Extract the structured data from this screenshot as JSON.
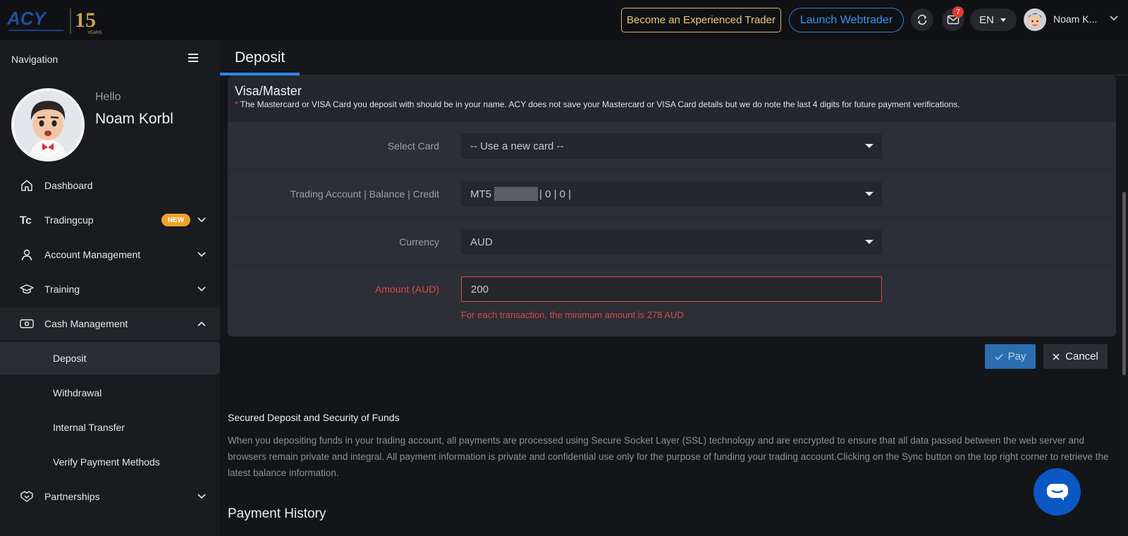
{
  "header": {
    "brand_text": "ACY",
    "anniversary": "15 YEARS",
    "become_trader_label": "Become an Experienced Trader",
    "launch_webtrader_label": "Launch Webtrader",
    "mail_count": "7",
    "language": "EN",
    "user_name": "Noam K..."
  },
  "sidebar": {
    "title": "Navigation",
    "hello": "Hello",
    "user_name": "Noam Korbl",
    "items": [
      {
        "label": "Dashboard",
        "icon": "home-icon"
      },
      {
        "label": "Tradingcup",
        "icon": "tc-icon",
        "badge": "NEW"
      },
      {
        "label": "Account Management",
        "icon": "user-icon"
      },
      {
        "label": "Training",
        "icon": "graduation-cap-icon"
      },
      {
        "label": "Cash Management",
        "icon": "cash-icon"
      },
      {
        "label": "Partnerships",
        "icon": "handshake-icon"
      }
    ],
    "sub_items": [
      {
        "label": "Deposit",
        "active": true
      },
      {
        "label": "Withdrawal"
      },
      {
        "label": "Internal Transfer"
      },
      {
        "label": "Verify Payment Methods"
      }
    ]
  },
  "page": {
    "title": "Deposit"
  },
  "card": {
    "title": "Visa/Master",
    "note": "The Mastercard or VISA Card you deposit with should be in your name. ACY does not save your Mastercard or VISA Card details but we do note the last 4 digits for future payment verifications.",
    "fields": {
      "select_card": {
        "label": "Select Card",
        "value": "-- Use a new card --"
      },
      "trading_account": {
        "label": "Trading Account | Balance | Credit",
        "prefix": "MT5",
        "suffix": "| 0 | 0 |"
      },
      "currency": {
        "label": "Currency",
        "value": "AUD"
      },
      "amount": {
        "label": "Amount (AUD)",
        "value": "200",
        "error": "For each transaction, the minimum amount is 278 AUD"
      }
    },
    "pay_label": "Pay",
    "cancel_label": "Cancel"
  },
  "security": {
    "title": "Secured Deposit and Security of Funds",
    "text": "When you depositing funds in your trading account, all payments are processed using Secure Socket Layer (SSL) technology and are encrypted to ensure that all data passed between the web server and browsers remain private and integral. All payment information is private and confidential use only for the purpose of funding your trading account.Clicking on the Sync button on the top right corner to retrieve the latest balance information."
  },
  "payment_history": {
    "title": "Payment History"
  },
  "colors": {
    "accent_blue": "#2d86e6",
    "error_red": "#d8494a",
    "gold": "#ecc978",
    "new_badge": "#f0a22b"
  }
}
